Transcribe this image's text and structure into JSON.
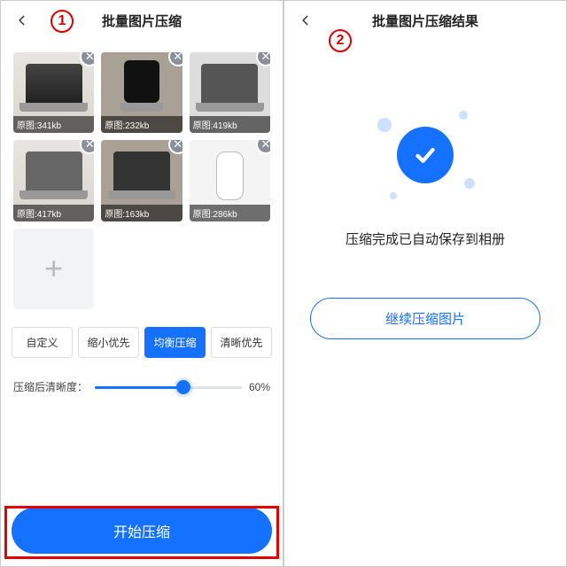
{
  "step_labels": {
    "one": "1",
    "two": "2"
  },
  "screen1": {
    "title": "批量图片压缩",
    "thumbnails": [
      {
        "caption": "原图:341kb"
      },
      {
        "caption": "原图:232kb"
      },
      {
        "caption": "原图:419kb"
      },
      {
        "caption": "原图:417kb"
      },
      {
        "caption": "原图:163kb"
      },
      {
        "caption": "原图:286kb"
      }
    ],
    "add_symbol": "+",
    "close_symbol": "✕",
    "modes": {
      "custom": "自定义",
      "small": "缩小优先",
      "balanced": "均衡压缩",
      "clear": "清晰优先",
      "active_index": 2
    },
    "slider": {
      "label": "压缩后清晰度：",
      "value_text": "60%",
      "value_pct": 60
    },
    "primary": "开始压缩"
  },
  "screen2": {
    "title": "批量图片压缩结果",
    "message": "压缩完成已自动保存到相册",
    "continue": "继续压缩图片"
  }
}
